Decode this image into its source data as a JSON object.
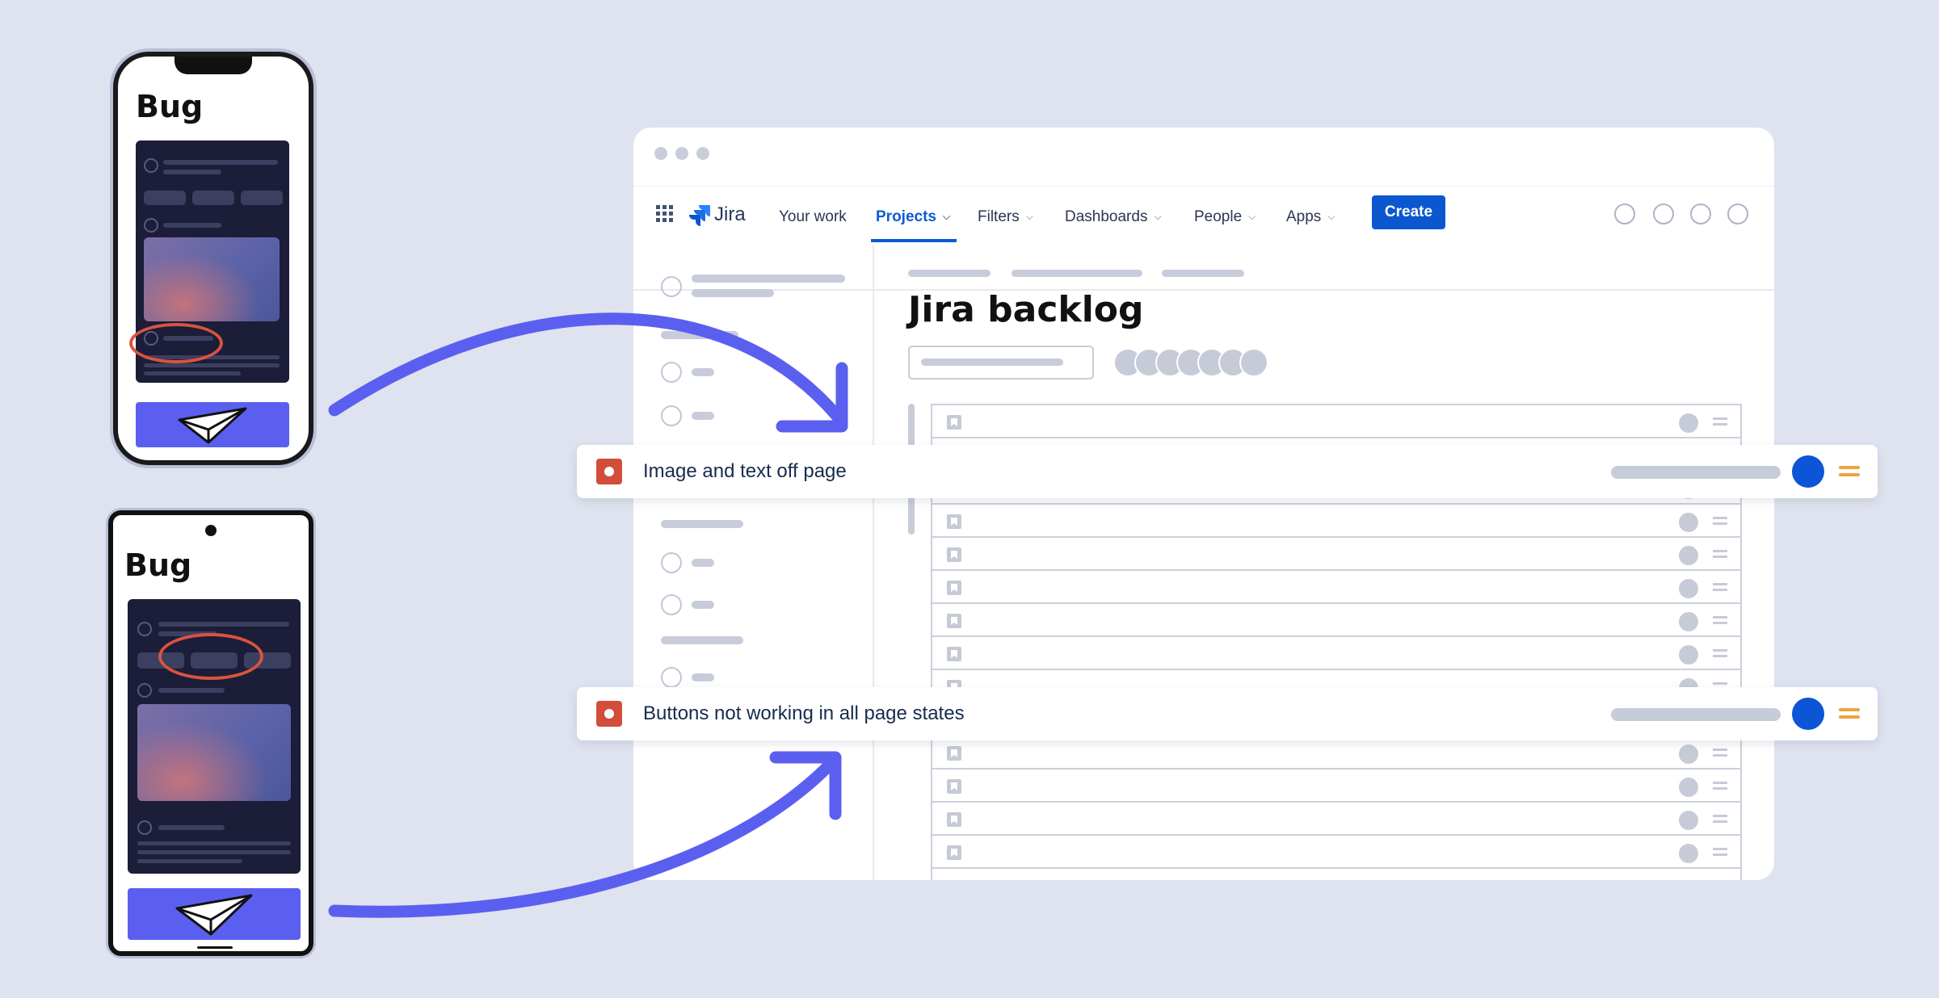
{
  "colors": {
    "background": "#dfe3ef",
    "accent_blue": "#0b57d0",
    "arrow_purple": "#5b5ff0",
    "bug_red": "#d24d3a",
    "priority_orange": "#f0a23b"
  },
  "phones": [
    {
      "title": "Bug",
      "device": "iphone"
    },
    {
      "title": "Bug",
      "device": "android"
    }
  ],
  "jira": {
    "logo_text": "Jira",
    "nav": [
      {
        "label": "Your work",
        "dropdown": false,
        "active": false
      },
      {
        "label": "Projects",
        "dropdown": true,
        "active": true
      },
      {
        "label": "Filters",
        "dropdown": true,
        "active": false
      },
      {
        "label": "Dashboards",
        "dropdown": true,
        "active": false
      },
      {
        "label": "People",
        "dropdown": true,
        "active": false
      },
      {
        "label": "Apps",
        "dropdown": true,
        "active": false
      }
    ],
    "create_label": "Create",
    "page_title": "Jira backlog"
  },
  "issues": [
    {
      "title": "Image and text off page",
      "type_icon": "bug-icon",
      "priority_icon": "priority-medium-icon"
    },
    {
      "title": "Buttons not working in all page states",
      "type_icon": "bug-icon",
      "priority_icon": "priority-medium-icon"
    }
  ]
}
